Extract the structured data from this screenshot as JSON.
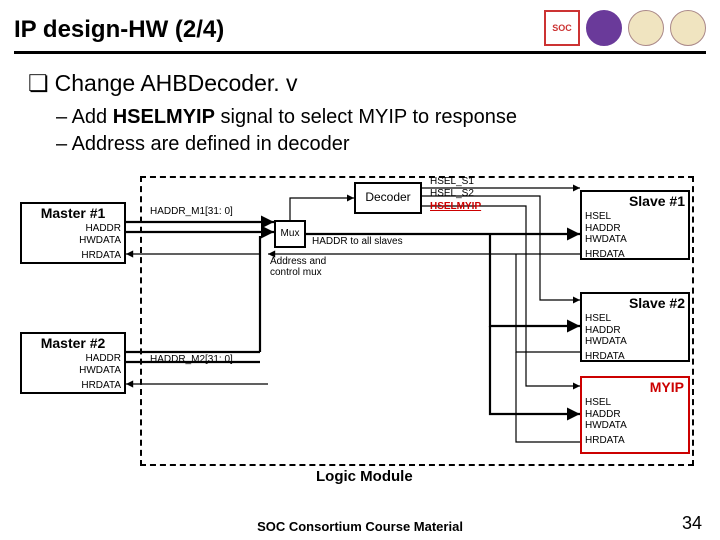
{
  "header": {
    "title": "IP design-HW (2/4)"
  },
  "logos": {
    "soc": "SOC",
    "l2": "",
    "l3": "",
    "l4": ""
  },
  "bullet_main": "Change AHBDecoder. v",
  "bullets": [
    {
      "prefix": "– Add ",
      "bold": "HSELMYIP",
      "rest": " signal to select MYIP to response"
    },
    {
      "prefix": "– Address are defined in decoder",
      "bold": "",
      "rest": ""
    }
  ],
  "diagram": {
    "logic_module": "Logic Module",
    "master1": {
      "title": "Master #1",
      "sig1": "HADDR",
      "sig2": "HWDATA",
      "sig3": "HRDATA"
    },
    "master2": {
      "title": "Master #2",
      "sig1": "HADDR",
      "sig2": "HWDATA",
      "sig3": "HRDATA"
    },
    "decoder": {
      "label": "Decoder"
    },
    "mux": {
      "label": "Mux"
    },
    "haddr_m1": "HADDR_M1[31: 0]",
    "haddr_m2": "HADDR_M2[31: 0]",
    "haddr_all": "HADDR to all slaves",
    "addr_mux_note": "Address and\ncontrol mux",
    "hsel_s1": "HSEL_S1",
    "hsel_s2": "HSEL_S2",
    "hselmyip": "HSELMYIP",
    "slave1": {
      "title": "Slave #1",
      "s1": "HSEL",
      "s2": "HADDR",
      "s3": "HWDATA",
      "s4": "HRDATA"
    },
    "slave2": {
      "title": "Slave #2",
      "s1": "HSEL",
      "s2": "HADDR",
      "s3": "HWDATA",
      "s4": "HRDATA"
    },
    "myip": {
      "title": "MYIP",
      "s1": "HSEL",
      "s2": "HADDR",
      "s3": "HWDATA",
      "s4": "HRDATA"
    }
  },
  "footer": {
    "course": "SOC Consortium Course Material",
    "page": "34"
  }
}
